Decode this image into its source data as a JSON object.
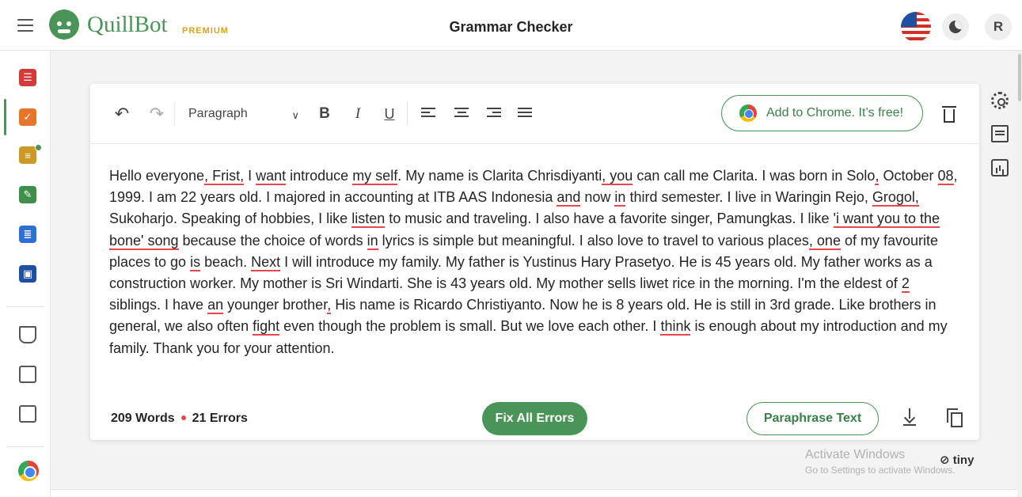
{
  "header": {
    "logo_text": "QuillBot",
    "premium_label": "PREMIUM",
    "title": "Grammar Checker",
    "avatar_initial": "R"
  },
  "toolbar": {
    "paragraph_select": "Paragraph",
    "bold": "B",
    "italic": "I",
    "underline": "U",
    "chrome_cta": "Add to Chrome. It’s free!"
  },
  "editor": {
    "text": [
      {
        "t": "Hello everyone"
      },
      {
        "t": ", Frist,",
        "e": true
      },
      {
        "t": " I "
      },
      {
        "t": "want",
        "e": true
      },
      {
        "t": " introduce "
      },
      {
        "t": "my self",
        "e": true
      },
      {
        "t": ". My name is Clarita Chrisdiyanti"
      },
      {
        "t": ", you",
        "e": true
      },
      {
        "t": " can call me Clarita. I was born in Solo"
      },
      {
        "t": ",",
        "e": true
      },
      {
        "t": " October "
      },
      {
        "t": "08",
        "e": true
      },
      {
        "t": ", 1999. I am 22 years old. I majored in accounting at ITB AAS Indonesia "
      },
      {
        "t": "and",
        "e": true
      },
      {
        "t": " now "
      },
      {
        "t": "in",
        "e": true
      },
      {
        "t": " third semester. I live in Waringin Rejo, "
      },
      {
        "t": "Grogol,",
        "e": true
      },
      {
        "t": " Sukoharjo. Speaking of hobbies, I like "
      },
      {
        "t": "listen",
        "e": true
      },
      {
        "t": " to music and traveling. I also have a favorite singer, Pamungkas. I like "
      },
      {
        "t": "'i want you to the bone' song",
        "e": true
      },
      {
        "t": " because the choice of words "
      },
      {
        "t": "in",
        "e": true
      },
      {
        "t": " lyrics is simple but meaningful. I also love to travel to various places"
      },
      {
        "t": ", one",
        "e": true
      },
      {
        "t": " of my favourite places to go "
      },
      {
        "t": "is",
        "e": true
      },
      {
        "t": " beach. "
      },
      {
        "t": "Next",
        "e": true
      },
      {
        "t": " I will introduce my family. My father is Yustinus Hary Prasetyo. He is 45 years old. My father works as a construction worker. My mother is Sri Windarti. She is 43 years old. My mother sells liwet rice in the morning. I'm the eldest of "
      },
      {
        "t": "2",
        "e": true
      },
      {
        "t": " siblings. I have "
      },
      {
        "t": "an",
        "e": true
      },
      {
        "t": " younger brother"
      },
      {
        "t": ",",
        "e": true
      },
      {
        "t": " His name is Ricardo Christiyanto. Now he is 8 years old. He is still in 3rd grade. Like brothers in general, we also often "
      },
      {
        "t": "fight",
        "e": true
      },
      {
        "t": " even though the problem is small. But we love each other. I "
      },
      {
        "t": "think",
        "e": true
      },
      {
        "t": " is enough about my introduction and my family. Thank you for your attention."
      }
    ]
  },
  "footer": {
    "word_count": "209 Words",
    "error_count": "21 Errors",
    "fix_button": "Fix All Errors",
    "paraphrase_button": "Paraphrase Text"
  },
  "watermark": {
    "line1": "Activate Windows",
    "line2": "Go to Settings to activate Windows.",
    "tiny": "tiny"
  },
  "colors": {
    "brand": "#499557",
    "error_underline": "#e5484d",
    "premium": "#d9a21c"
  }
}
